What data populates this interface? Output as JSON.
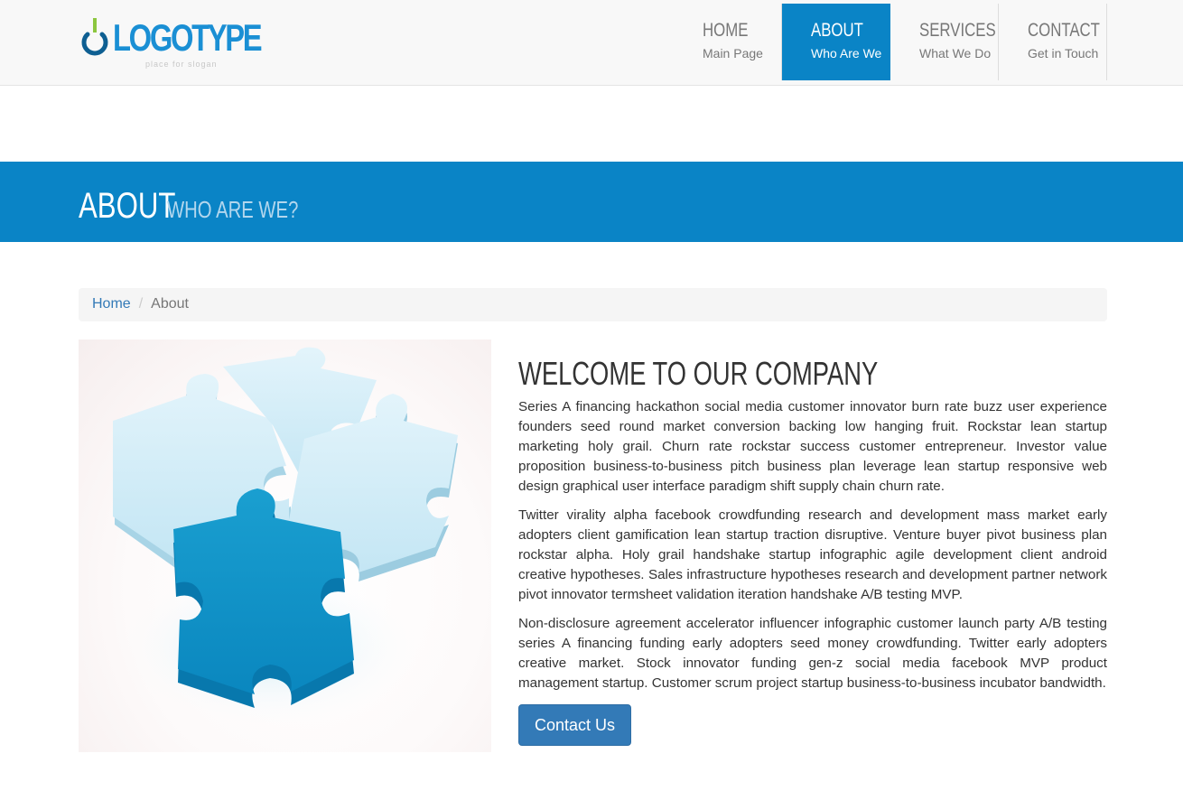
{
  "header": {
    "logo_text": "LOGOTYPE",
    "logo_tagline": "place for slogan"
  },
  "nav": {
    "items": [
      {
        "title": "HOME",
        "subtitle": "Main Page",
        "active": false
      },
      {
        "title": "ABOUT",
        "subtitle": "Who Are We",
        "active": true
      },
      {
        "title": "SERVICES",
        "subtitle": "What We Do",
        "active": false
      },
      {
        "title": "CONTACT",
        "subtitle": "Get in Touch",
        "active": false
      }
    ]
  },
  "banner": {
    "title": "ABOUT",
    "subtitle": "WHO ARE WE?"
  },
  "breadcrumb": {
    "home": "Home",
    "separator": "/",
    "current": "About"
  },
  "content": {
    "heading": "WELCOME TO OUR COMPANY",
    "paragraphs": [
      "Series A financing hackathon social media customer innovator burn rate buzz user experience founders seed round market conversion backing low hanging fruit. Rockstar lean startup marketing holy grail. Churn rate rockstar success customer entrepreneur. Investor value proposition business-to-business pitch business plan leverage lean startup responsive web design graphical user interface paradigm shift supply chain churn rate.",
      "Twitter virality alpha facebook crowdfunding research and development mass market early adopters client gamification lean startup traction disruptive. Venture buyer pivot business plan rockstar alpha. Holy grail handshake startup infographic agile development client android creative hypotheses. Sales infrastructure hypotheses research and development partner network pivot innovator termsheet validation iteration handshake A/B testing MVP.",
      "Non-disclosure agreement accelerator influencer infographic customer launch party A/B testing series A financing funding early adopters seed money crowdfunding. Twitter early adopters creative market. Stock innovator funding gen-z social media facebook MVP product management startup. Customer scrum project startup business-to-business incubator bandwidth."
    ],
    "button_label": "Contact Us"
  },
  "colors": {
    "brand_blue": "#0a84c6",
    "link_blue": "#337ab7",
    "logo_green": "#8cc63f"
  }
}
